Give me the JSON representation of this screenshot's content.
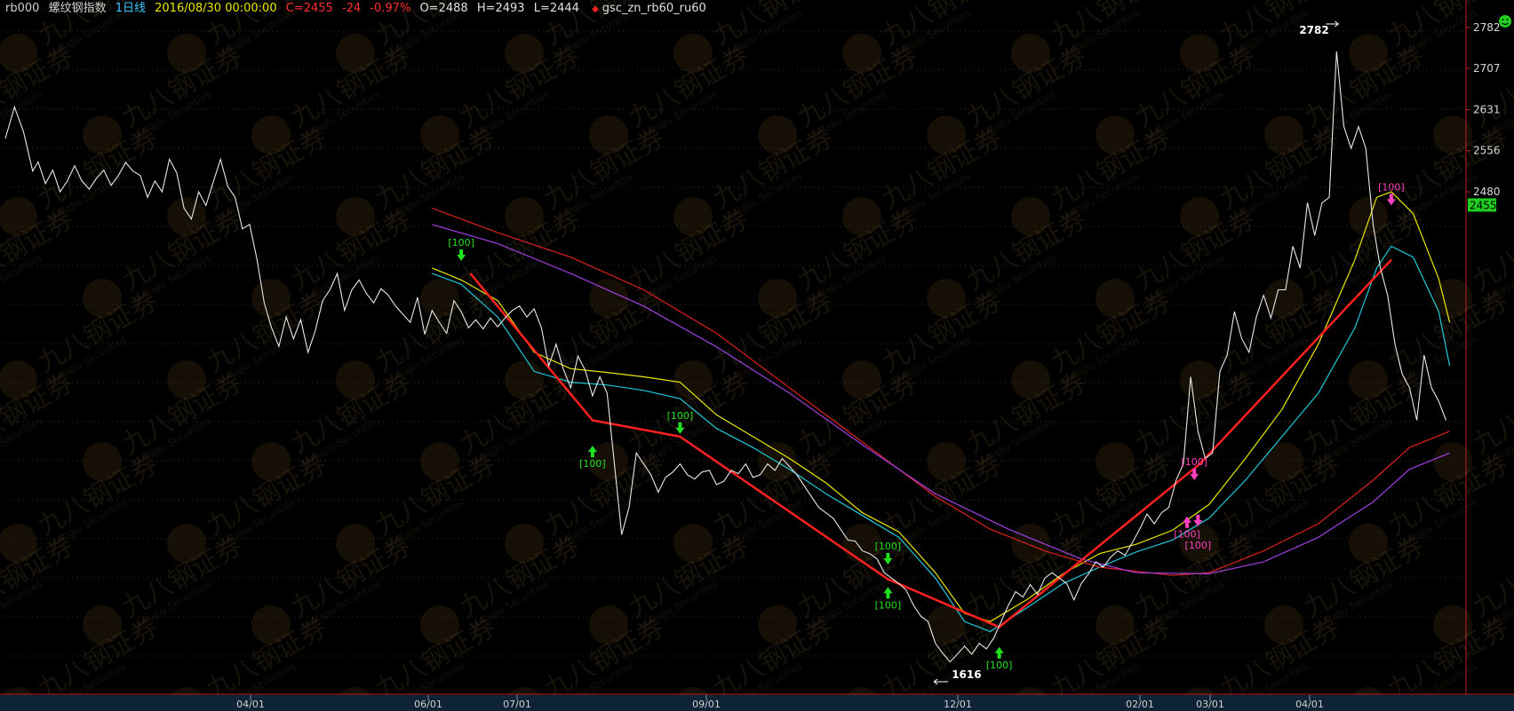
{
  "header": {
    "symbol": "rb000",
    "name": "螺纹钢指数",
    "period": "1日线",
    "datetime": "2016/08/30 00:00:00",
    "close": "C=2455",
    "change": "-24",
    "change_pct": "-0.97%",
    "open": "O=2488",
    "high": "H=2493",
    "low": "L=2444",
    "strategy": "gsc_zn_rb60_ru60",
    "colors": {
      "symbol": "#d0d0d0",
      "period": "#40c8ff",
      "datetime": "#e8e800",
      "down": "#ff3030",
      "ohlc": "#e0e0e0"
    }
  },
  "status_icon": "smiley-icon",
  "watermark": {
    "text_cn": "九八钢证券",
    "text_en": "JiuBaJiu Securities"
  },
  "chart_data": {
    "type": "line",
    "ylim": [
      1560,
      2800
    ],
    "y_ticks": [
      2782,
      2707,
      2631,
      2556,
      2480
    ],
    "current_price": "2455",
    "x_labels": [
      "04/01",
      "06/01",
      "07/01",
      "09/01",
      "12/01",
      "02/01",
      "03/01",
      "04/01"
    ],
    "max_label": "2782",
    "min_label": "1616",
    "price": [
      [
        0,
        2578
      ],
      [
        5,
        2636
      ],
      [
        10,
        2590
      ],
      [
        15,
        2518
      ],
      [
        18,
        2535
      ],
      [
        22,
        2495
      ],
      [
        26,
        2520
      ],
      [
        30,
        2480
      ],
      [
        34,
        2500
      ],
      [
        38,
        2528
      ],
      [
        42,
        2500
      ],
      [
        46,
        2485
      ],
      [
        50,
        2505
      ],
      [
        54,
        2520
      ],
      [
        58,
        2492
      ],
      [
        62,
        2510
      ],
      [
        66,
        2534
      ],
      [
        70,
        2518
      ],
      [
        74,
        2510
      ],
      [
        78,
        2470
      ],
      [
        82,
        2500
      ],
      [
        86,
        2480
      ],
      [
        90,
        2540
      ],
      [
        94,
        2515
      ],
      [
        98,
        2450
      ],
      [
        102,
        2430
      ],
      [
        106,
        2480
      ],
      [
        110,
        2455
      ],
      [
        114,
        2498
      ],
      [
        118,
        2540
      ],
      [
        122,
        2490
      ],
      [
        126,
        2470
      ],
      [
        130,
        2412
      ],
      [
        134,
        2420
      ],
      [
        138,
        2356
      ],
      [
        142,
        2275
      ],
      [
        146,
        2230
      ],
      [
        150,
        2196
      ],
      [
        154,
        2250
      ],
      [
        158,
        2210
      ],
      [
        162,
        2245
      ],
      [
        166,
        2185
      ],
      [
        170,
        2225
      ],
      [
        174,
        2280
      ],
      [
        178,
        2300
      ],
      [
        182,
        2330
      ],
      [
        186,
        2262
      ],
      [
        190,
        2300
      ],
      [
        194,
        2318
      ],
      [
        198,
        2293
      ],
      [
        202,
        2276
      ],
      [
        206,
        2302
      ],
      [
        210,
        2290
      ],
      [
        214,
        2270
      ],
      [
        218,
        2255
      ],
      [
        222,
        2240
      ],
      [
        226,
        2286
      ],
      [
        230,
        2218
      ],
      [
        234,
        2262
      ],
      [
        238,
        2240
      ],
      [
        242,
        2220
      ],
      [
        246,
        2280
      ],
      [
        250,
        2260
      ],
      [
        254,
        2230
      ],
      [
        258,
        2245
      ],
      [
        262,
        2228
      ],
      [
        266,
        2248
      ],
      [
        270,
        2232
      ],
      [
        274,
        2248
      ],
      [
        278,
        2262
      ],
      [
        282,
        2270
      ],
      [
        286,
        2250
      ],
      [
        290,
        2265
      ],
      [
        294,
        2230
      ],
      [
        298,
        2160
      ],
      [
        302,
        2200
      ],
      [
        306,
        2154
      ],
      [
        310,
        2120
      ],
      [
        314,
        2178
      ],
      [
        318,
        2152
      ],
      [
        322,
        2105
      ],
      [
        326,
        2140
      ],
      [
        330,
        2110
      ],
      [
        334,
        1980
      ],
      [
        338,
        1850
      ],
      [
        342,
        1900
      ],
      [
        346,
        2000
      ],
      [
        350,
        1980
      ],
      [
        354,
        1960
      ],
      [
        358,
        1928
      ],
      [
        362,
        1955
      ],
      [
        366,
        1965
      ],
      [
        370,
        1980
      ],
      [
        374,
        1960
      ],
      [
        378,
        1952
      ],
      [
        382,
        1965
      ],
      [
        386,
        1968
      ],
      [
        390,
        1942
      ],
      [
        394,
        1948
      ],
      [
        398,
        1968
      ],
      [
        402,
        1962
      ],
      [
        406,
        1980
      ],
      [
        410,
        1955
      ],
      [
        414,
        1960
      ],
      [
        418,
        1980
      ],
      [
        422,
        1968
      ],
      [
        426,
        1990
      ],
      [
        430,
        1975
      ],
      [
        434,
        1960
      ],
      [
        438,
        1940
      ],
      [
        442,
        1920
      ],
      [
        446,
        1900
      ],
      [
        450,
        1890
      ],
      [
        454,
        1880
      ],
      [
        458,
        1860
      ],
      [
        462,
        1840
      ],
      [
        466,
        1838
      ],
      [
        470,
        1820
      ],
      [
        474,
        1815
      ],
      [
        478,
        1805
      ],
      [
        482,
        1780
      ],
      [
        486,
        1770
      ],
      [
        490,
        1760
      ],
      [
        494,
        1748
      ],
      [
        498,
        1720
      ],
      [
        502,
        1700
      ],
      [
        506,
        1690
      ],
      [
        510,
        1650
      ],
      [
        514,
        1632
      ],
      [
        518,
        1616
      ],
      [
        522,
        1630
      ],
      [
        526,
        1645
      ],
      [
        530,
        1630
      ],
      [
        534,
        1650
      ],
      [
        538,
        1640
      ],
      [
        542,
        1660
      ],
      [
        546,
        1690
      ],
      [
        550,
        1720
      ],
      [
        554,
        1745
      ],
      [
        558,
        1735
      ],
      [
        562,
        1758
      ],
      [
        566,
        1740
      ],
      [
        570,
        1770
      ],
      [
        574,
        1780
      ],
      [
        578,
        1770
      ],
      [
        582,
        1760
      ],
      [
        586,
        1730
      ],
      [
        590,
        1760
      ],
      [
        594,
        1778
      ],
      [
        598,
        1800
      ],
      [
        602,
        1790
      ],
      [
        606,
        1808
      ],
      [
        610,
        1820
      ],
      [
        614,
        1812
      ],
      [
        618,
        1835
      ],
      [
        622,
        1860
      ],
      [
        626,
        1888
      ],
      [
        630,
        1870
      ],
      [
        634,
        1890
      ],
      [
        638,
        1900
      ],
      [
        642,
        1950
      ],
      [
        646,
        1980
      ],
      [
        650,
        2140
      ],
      [
        654,
        2040
      ],
      [
        658,
        1990
      ],
      [
        662,
        2000
      ],
      [
        666,
        2150
      ],
      [
        670,
        2180
      ],
      [
        674,
        2260
      ],
      [
        678,
        2210
      ],
      [
        682,
        2185
      ],
      [
        686,
        2250
      ],
      [
        690,
        2290
      ],
      [
        694,
        2248
      ],
      [
        698,
        2300
      ],
      [
        702,
        2300
      ],
      [
        706,
        2380
      ],
      [
        710,
        2340
      ],
      [
        714,
        2460
      ],
      [
        718,
        2400
      ],
      [
        722,
        2460
      ],
      [
        726,
        2470
      ],
      [
        730,
        2738
      ],
      [
        734,
        2600
      ],
      [
        738,
        2560
      ],
      [
        742,
        2600
      ],
      [
        746,
        2560
      ],
      [
        750,
        2420
      ],
      [
        754,
        2340
      ],
      [
        758,
        2290
      ],
      [
        762,
        2200
      ],
      [
        766,
        2145
      ],
      [
        770,
        2120
      ],
      [
        774,
        2060
      ],
      [
        778,
        2180
      ],
      [
        782,
        2120
      ],
      [
        786,
        2095
      ],
      [
        790,
        2060
      ]
    ],
    "series": [
      {
        "color": "#e8e800",
        "values": [
          [
            234,
            2340
          ],
          [
            250,
            2318
          ],
          [
            270,
            2280
          ],
          [
            290,
            2185
          ],
          [
            310,
            2155
          ],
          [
            330,
            2148
          ],
          [
            350,
            2140
          ],
          [
            370,
            2130
          ],
          [
            390,
            2070
          ],
          [
            410,
            2030
          ],
          [
            430,
            1990
          ],
          [
            450,
            1945
          ],
          [
            470,
            1890
          ],
          [
            490,
            1855
          ],
          [
            510,
            1780
          ],
          [
            526,
            1705
          ],
          [
            540,
            1690
          ],
          [
            560,
            1730
          ],
          [
            580,
            1778
          ],
          [
            600,
            1815
          ],
          [
            620,
            1832
          ],
          [
            640,
            1858
          ],
          [
            660,
            1905
          ],
          [
            680,
            1990
          ],
          [
            700,
            2080
          ],
          [
            720,
            2200
          ],
          [
            740,
            2355
          ],
          [
            752,
            2470
          ],
          [
            760,
            2480
          ],
          [
            772,
            2440
          ],
          [
            786,
            2320
          ],
          [
            792,
            2240
          ]
        ]
      },
      {
        "color": "#20c8d8",
        "values": [
          [
            234,
            2330
          ],
          [
            250,
            2310
          ],
          [
            270,
            2250
          ],
          [
            290,
            2150
          ],
          [
            310,
            2130
          ],
          [
            330,
            2125
          ],
          [
            350,
            2115
          ],
          [
            370,
            2100
          ],
          [
            390,
            2045
          ],
          [
            410,
            2010
          ],
          [
            430,
            1970
          ],
          [
            450,
            1925
          ],
          [
            470,
            1885
          ],
          [
            490,
            1845
          ],
          [
            510,
            1770
          ],
          [
            526,
            1690
          ],
          [
            540,
            1672
          ],
          [
            560,
            1715
          ],
          [
            580,
            1760
          ],
          [
            600,
            1790
          ],
          [
            620,
            1818
          ],
          [
            640,
            1840
          ],
          [
            660,
            1880
          ],
          [
            680,
            1950
          ],
          [
            700,
            2030
          ],
          [
            720,
            2110
          ],
          [
            740,
            2230
          ],
          [
            752,
            2340
          ],
          [
            760,
            2380
          ],
          [
            772,
            2360
          ],
          [
            786,
            2260
          ],
          [
            792,
            2160
          ]
        ]
      },
      {
        "color": "#e02020",
        "values": [
          [
            234,
            2450
          ],
          [
            270,
            2405
          ],
          [
            310,
            2360
          ],
          [
            350,
            2300
          ],
          [
            390,
            2220
          ],
          [
            430,
            2120
          ],
          [
            470,
            2020
          ],
          [
            510,
            1920
          ],
          [
            540,
            1860
          ],
          [
            570,
            1820
          ],
          [
            600,
            1790
          ],
          [
            640,
            1775
          ],
          [
            660,
            1780
          ],
          [
            690,
            1820
          ],
          [
            720,
            1870
          ],
          [
            750,
            1950
          ],
          [
            770,
            2010
          ],
          [
            792,
            2040
          ]
        ]
      },
      {
        "color": "#a040e0",
        "values": [
          [
            234,
            2420
          ],
          [
            270,
            2385
          ],
          [
            310,
            2330
          ],
          [
            350,
            2270
          ],
          [
            390,
            2195
          ],
          [
            430,
            2110
          ],
          [
            470,
            2015
          ],
          [
            510,
            1925
          ],
          [
            550,
            1860
          ],
          [
            590,
            1805
          ],
          [
            620,
            1780
          ],
          [
            660,
            1778
          ],
          [
            690,
            1800
          ],
          [
            720,
            1845
          ],
          [
            750,
            1910
          ],
          [
            770,
            1970
          ],
          [
            792,
            2000
          ]
        ]
      },
      {
        "color": "#ff2020",
        "values": [
          [
            255,
            2330
          ],
          [
            322,
            2060
          ],
          [
            370,
            2030
          ],
          [
            484,
            1768
          ],
          [
            545,
            1680
          ],
          [
            655,
            1980
          ],
          [
            760,
            2355
          ]
        ]
      }
    ],
    "signals": [
      {
        "x": 250,
        "y": 2358,
        "label": "[100]",
        "color": "#20e020",
        "pos": "above",
        "arrow": "down"
      },
      {
        "x": 322,
        "y": 2020,
        "label": "[100]",
        "color": "#20e020",
        "pos": "below",
        "arrow": "up"
      },
      {
        "x": 370,
        "y": 2040,
        "label": "[100]",
        "color": "#20e020",
        "pos": "above",
        "arrow": "down"
      },
      {
        "x": 484,
        "y": 1800,
        "label": "[100]",
        "color": "#20e020",
        "pos": "above",
        "arrow": "down"
      },
      {
        "x": 484,
        "y": 1760,
        "label": "[100]",
        "color": "#20e020",
        "pos": "below",
        "arrow": "up"
      },
      {
        "x": 545,
        "y": 1650,
        "label": "[100]",
        "color": "#20e020",
        "pos": "below",
        "arrow": "up"
      },
      {
        "x": 652,
        "y": 1955,
        "label": "[100]",
        "color": "#ff40c0",
        "pos": "above",
        "arrow": "down"
      },
      {
        "x": 648,
        "y": 1890,
        "label": "[100]",
        "color": "#ff40c0",
        "pos": "below",
        "arrow": "up"
      },
      {
        "x": 654,
        "y": 1870,
        "label": "[100]",
        "color": "#ff40c0",
        "pos": "below",
        "arrow": "down"
      },
      {
        "x": 760,
        "y": 2460,
        "label": "[100]",
        "color": "#ff40c0",
        "pos": "above",
        "arrow": "down"
      }
    ]
  }
}
